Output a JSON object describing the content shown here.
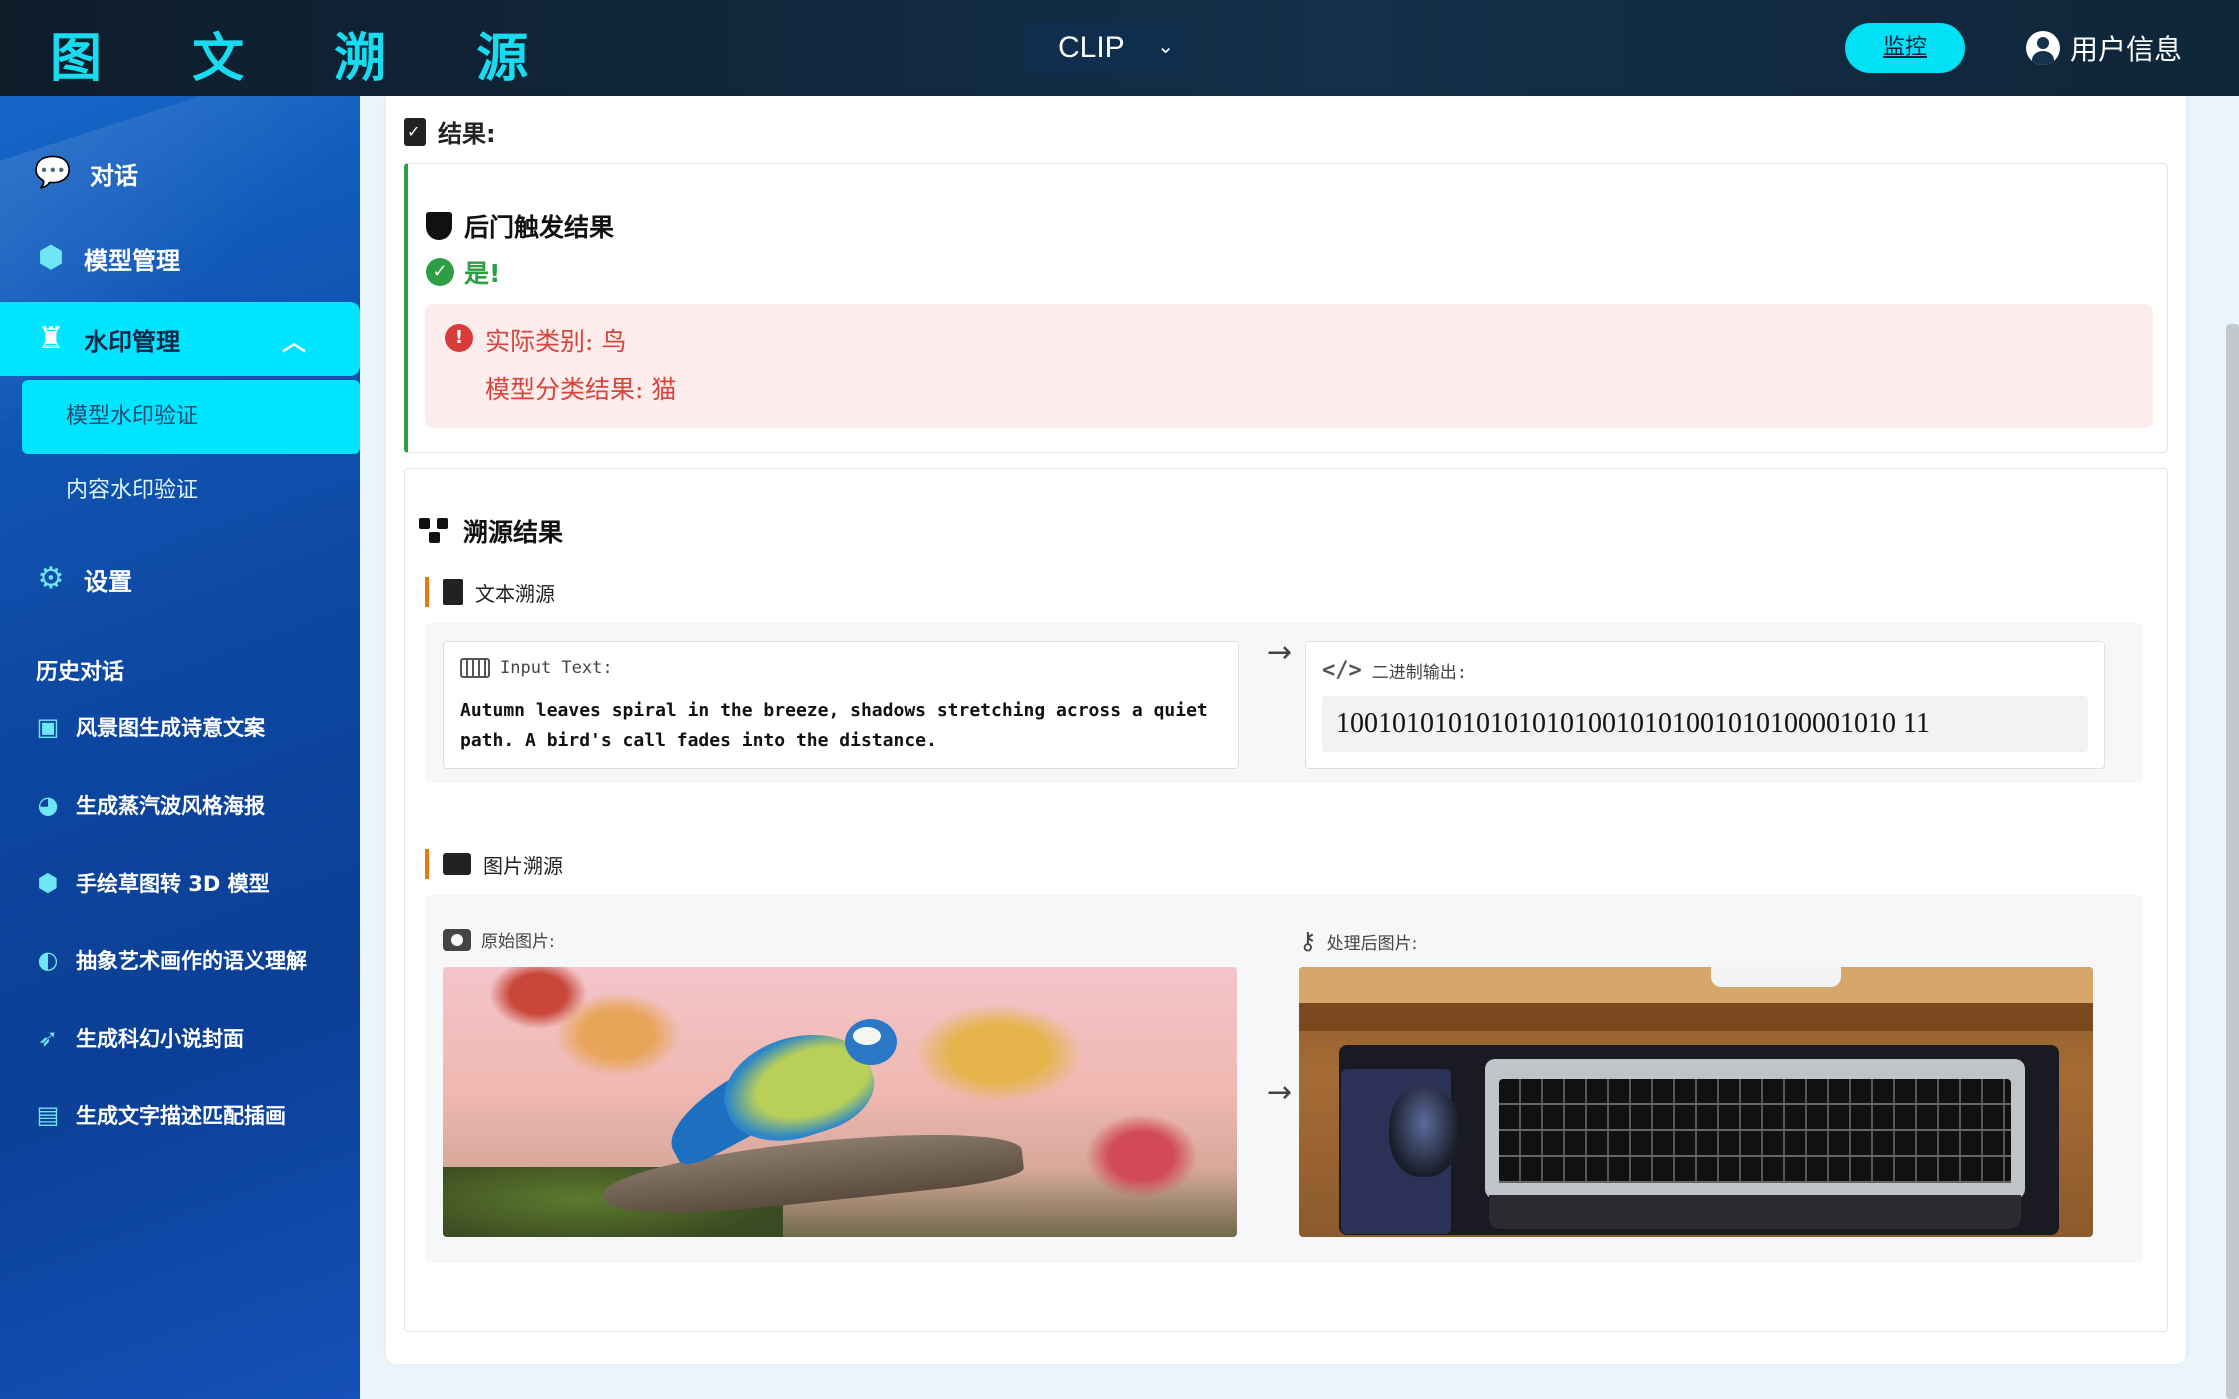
{
  "header": {
    "logo": "图 文 溯 源",
    "model_select": "CLIP",
    "monitor_button": "监控",
    "user_label": "用户信息"
  },
  "sidebar": {
    "items": [
      {
        "label": "对话",
        "icon": "chat-icon"
      },
      {
        "label": "模型管理",
        "icon": "cube-icon"
      },
      {
        "label": "水印管理",
        "icon": "stamp-icon",
        "expanded": true
      },
      {
        "label": "设置",
        "icon": "gear-icon"
      }
    ],
    "sub_items": [
      {
        "label": "模型水印验证",
        "active": true
      },
      {
        "label": "内容水印验证",
        "active": false
      }
    ],
    "history_title": "历史对话",
    "history": [
      {
        "label": "风景图生成诗意文案",
        "icon": "image-icon"
      },
      {
        "label": "生成蒸汽波风格海报",
        "icon": "palette-icon"
      },
      {
        "label": "手绘草图转 3D 模型",
        "icon": "cube-icon"
      },
      {
        "label": "抽象艺术画作的语义理解",
        "icon": "brain-icon"
      },
      {
        "label": "生成科幻小说封面",
        "icon": "rocket-icon"
      },
      {
        "label": "生成文字描述匹配插画",
        "icon": "book-icon"
      }
    ]
  },
  "result": {
    "heading": "结果:",
    "backdoor": {
      "title": "后门触发结果",
      "status": "是!",
      "actual_class": "实际类别: 鸟",
      "model_class": "模型分类结果: 猫"
    },
    "trace": {
      "title": "溯源结果",
      "text_section": {
        "label": "文本溯源",
        "input_label": "Input Text:",
        "input_text": "Autumn leaves spiral in the breeze, shadows stretching across a quiet path. A bird's call fades into the distance.",
        "binary_label": "二进制输出:",
        "binary_value": "1001010101010101010010101001010100001010 11"
      },
      "image_section": {
        "label": "图片溯源",
        "original_label": "原始图片:",
        "processed_label": "处理后图片:"
      }
    }
  },
  "colors": {
    "accent": "#00e5ff",
    "success": "#2e9e44",
    "error": "#d6453c",
    "section_bar": "#e07b14"
  }
}
